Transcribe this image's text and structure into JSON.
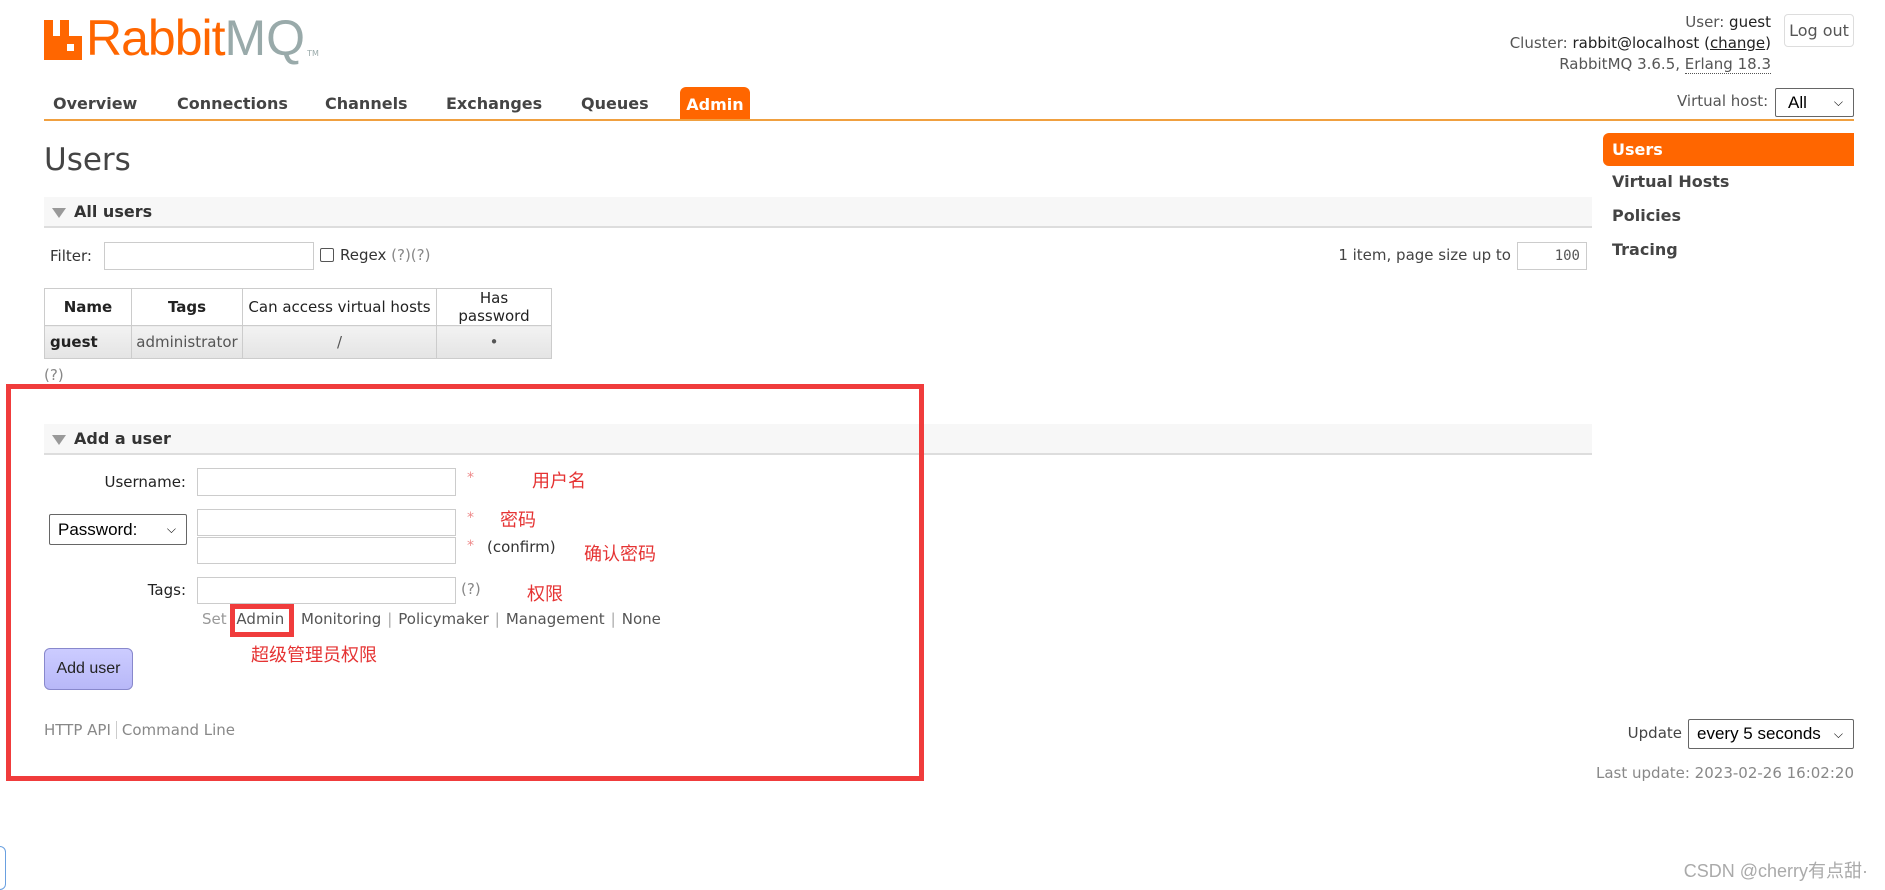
{
  "logo": {
    "part1": "Rabbit",
    "part2": "MQ",
    "tm": "TM"
  },
  "nav": {
    "tabs": [
      "Overview",
      "Connections",
      "Channels",
      "Exchanges",
      "Queues",
      "Admin"
    ],
    "active": "Admin"
  },
  "header": {
    "user_label": "User:",
    "user": "guest",
    "cluster_label": "Cluster:",
    "cluster": "rabbit@localhost",
    "change_link": "change",
    "version": "RabbitMQ 3.6.5,",
    "erlang": "Erlang 18.3",
    "logout": "Log out",
    "vhost_label": "Virtual host:",
    "vhost_value": "All"
  },
  "page_title": "Users",
  "sidebar": {
    "items": [
      "Users",
      "Virtual Hosts",
      "Policies",
      "Tracing"
    ],
    "active": "Users"
  },
  "all_users": {
    "heading": "All users",
    "filter_label": "Filter:",
    "filter_value": "",
    "regex_label": "Regex",
    "regex_help": "(?)(?)",
    "pagination_text": "1 item, page size up to",
    "page_size": "100",
    "columns": [
      "Name",
      "Tags",
      "Can access virtual hosts",
      "Has password"
    ],
    "rows": [
      {
        "name": "guest",
        "tags": "administrator",
        "vhosts": "/",
        "has_password": "•"
      }
    ],
    "help": "(?)"
  },
  "add_user": {
    "heading": "Add a user",
    "username_label": "Username:",
    "username_value": "",
    "password_select": "Password:",
    "password_value": "",
    "confirm_value": "",
    "confirm_label": "(confirm)",
    "required_mark": "*",
    "tags_label": "Tags:",
    "tags_value": "",
    "tags_help": "(?)",
    "set_label": "Set",
    "tag_options": [
      "Admin",
      "Monitoring",
      "Policymaker",
      "Management",
      "None"
    ],
    "submit": "Add user"
  },
  "annotations": {
    "username": "用户名",
    "password": "密码",
    "confirm": "确认密码",
    "tags": "权限",
    "admin": "超级管理员权限"
  },
  "footer": {
    "links": [
      "HTTP API",
      "Command Line"
    ],
    "update_label": "Update",
    "update_value": "every 5 seconds",
    "last_update": "Last update: 2023-02-26 16:02:20"
  },
  "watermark": "CSDN @cherry有点甜·",
  "colors": {
    "brand": "#ff6600",
    "annotation_red": "#f03c3c",
    "button": "#ccccff"
  }
}
